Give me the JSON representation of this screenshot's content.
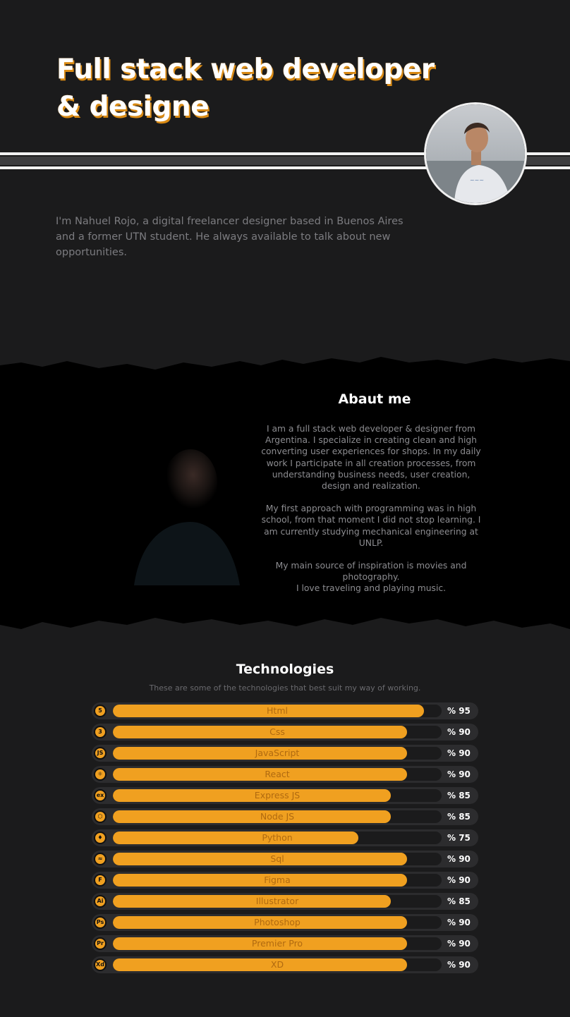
{
  "hero": {
    "title_line1": "Full stack web developer",
    "title_line2": "& designe",
    "intro": "I'm Nahuel Rojo, a digital freelancer designer based in Buenos Aires and a former UTN student. He always available to talk about new opportunities."
  },
  "about": {
    "title": "Abaut me",
    "paragraphs": [
      "I am a full stack web developer & designer from Argentina. I specialize in creating clean and high converting user experiences for shops. In my daily work I participate in all creation processes, from understanding business needs, user creation, design and realization.",
      "My first approach with programming was in high school, from that moment I did not stop learning. I am currently studying mechanical engineering at UNLP.",
      "My main source of inspiration is movies and photography.\nI love traveling and playing music."
    ]
  },
  "technologies": {
    "title": "Technologies",
    "subtitle": "These are some of the technologies that best suit my way of working.",
    "accent_color": "#f0a020",
    "items": [
      {
        "name": "Html",
        "percent": 95,
        "percent_label": "% 95",
        "icon": "html5-icon",
        "glyph": "5"
      },
      {
        "name": "Css",
        "percent": 90,
        "percent_label": "% 90",
        "icon": "css3-icon",
        "glyph": "3"
      },
      {
        "name": "JavaScript",
        "percent": 90,
        "percent_label": "% 90",
        "icon": "javascript-icon",
        "glyph": "JS"
      },
      {
        "name": "React",
        "percent": 90,
        "percent_label": "% 90",
        "icon": "react-icon",
        "glyph": "⚛"
      },
      {
        "name": "Express JS",
        "percent": 85,
        "percent_label": "% 85",
        "icon": "express-icon",
        "glyph": "ex"
      },
      {
        "name": "Node JS",
        "percent": 85,
        "percent_label": "% 85",
        "icon": "nodejs-icon",
        "glyph": "⬡"
      },
      {
        "name": "Python",
        "percent": 75,
        "percent_label": "% 75",
        "icon": "python-icon",
        "glyph": "♦"
      },
      {
        "name": "Sql",
        "percent": 90,
        "percent_label": "% 90",
        "icon": "mysql-icon",
        "glyph": "≈"
      },
      {
        "name": "Figma",
        "percent": 90,
        "percent_label": "% 90",
        "icon": "figma-icon",
        "glyph": "F"
      },
      {
        "name": "Illustrator",
        "percent": 85,
        "percent_label": "% 85",
        "icon": "illustrator-icon",
        "glyph": "Ai"
      },
      {
        "name": "Photoshop",
        "percent": 90,
        "percent_label": "% 90",
        "icon": "photoshop-icon",
        "glyph": "Ps"
      },
      {
        "name": "Premier Pro",
        "percent": 90,
        "percent_label": "% 90",
        "icon": "premiere-pro-icon",
        "glyph": "Pr"
      },
      {
        "name": "XD",
        "percent": 90,
        "percent_label": "% 90",
        "icon": "xd-icon",
        "glyph": "Xd"
      }
    ]
  }
}
